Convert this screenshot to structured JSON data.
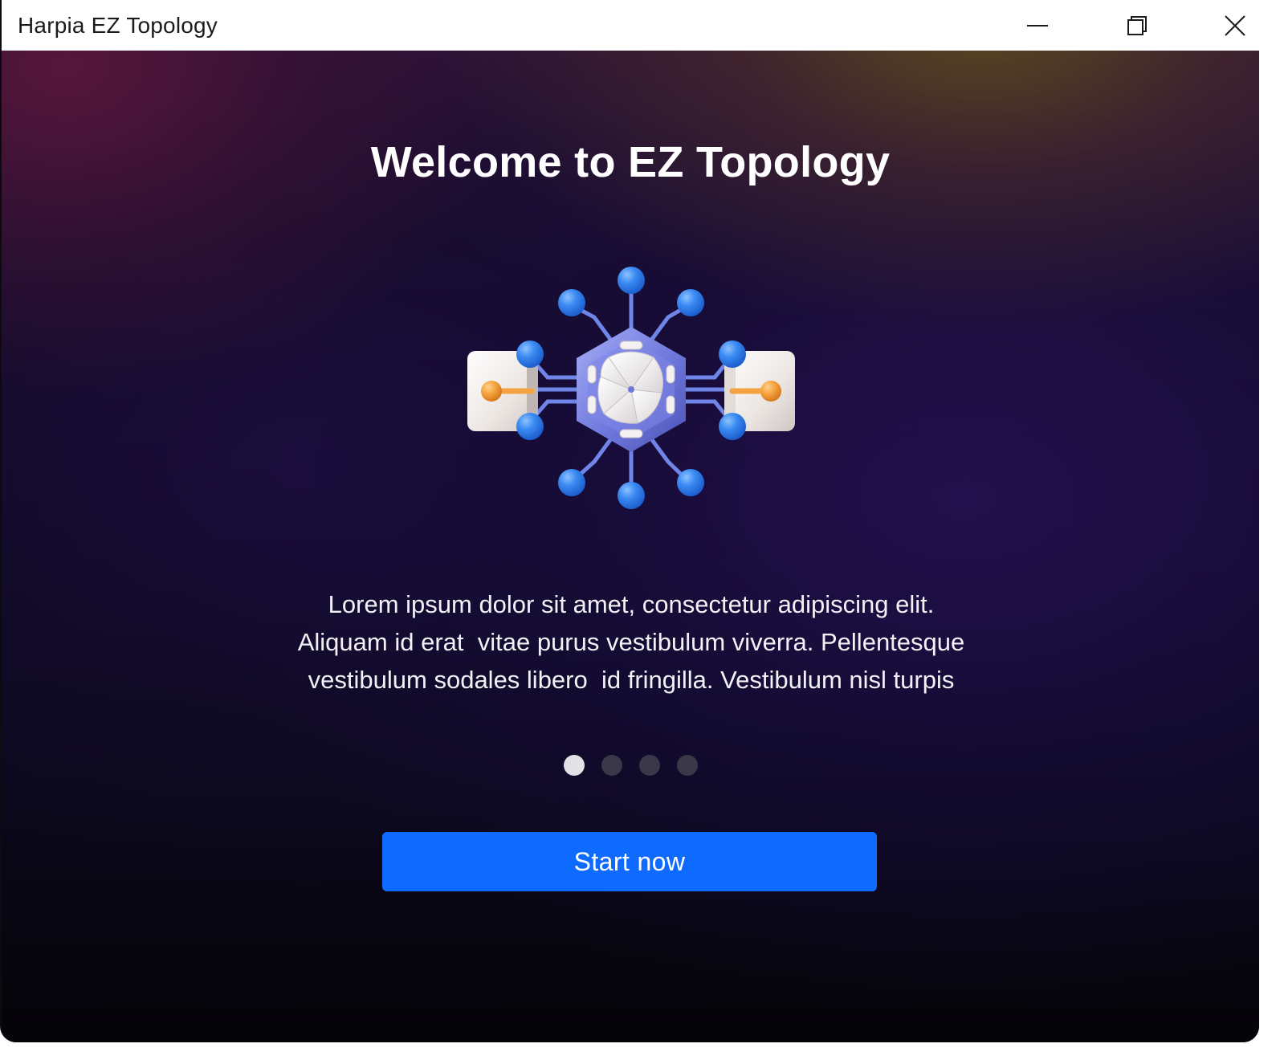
{
  "window": {
    "title": "Harpia EZ Topology",
    "controls": {
      "minimize_icon": "minimize-icon",
      "maximize_icon": "maximize-icon",
      "close_icon": "close-icon"
    }
  },
  "onboarding": {
    "title": "Welcome to EZ Topology",
    "illustration": "network-topology-illustration",
    "description_lines": [
      "Lorem ipsum dolor sit amet, consectetur adipiscing elit.",
      "Aliquam id erat  vitae purus vestibulum viverra. Pellentesque",
      "vestibulum sodales libero  id fringilla. Vestibulum nisl turpis"
    ],
    "pagination": {
      "total": 4,
      "current": 1
    },
    "start_button_label": "Start now"
  },
  "colors": {
    "accent": "#0f6bff",
    "dot_active": "#e2e2e6",
    "dot_inactive": "#3a3848",
    "node_blue": "#3a8bf2",
    "connector_orange": "#f5a340",
    "hub_purple": "#6f78dc"
  }
}
